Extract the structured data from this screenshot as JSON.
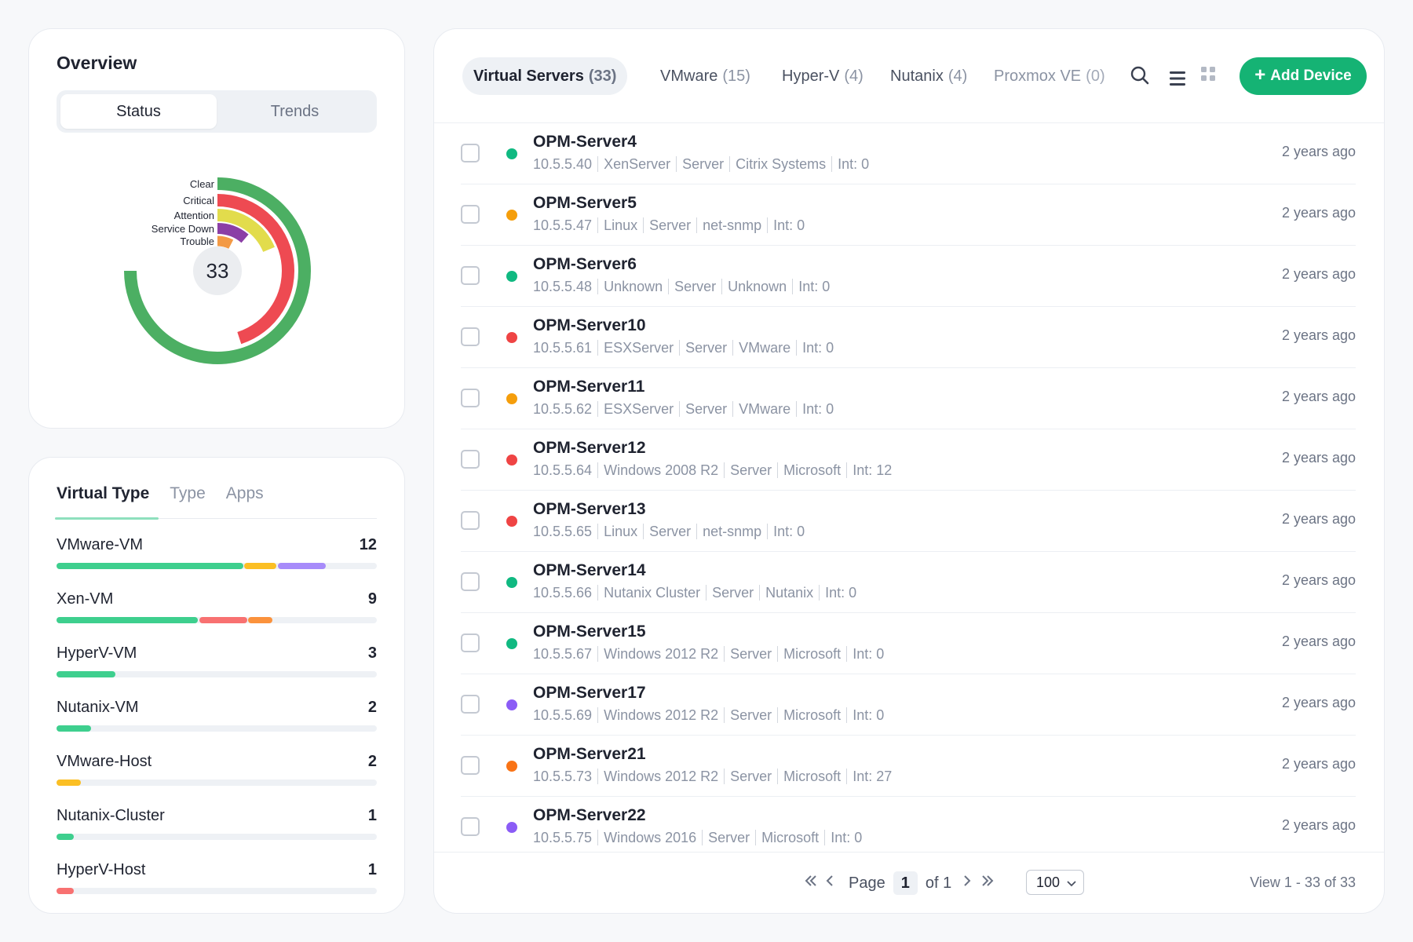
{
  "overview": {
    "title": "Overview",
    "tabs": [
      "Status",
      "Trends"
    ],
    "active_tab": "Status",
    "donut": {
      "total": "33",
      "series": [
        {
          "label": "Clear",
          "value": 20,
          "color": "#4caf63"
        },
        {
          "label": "Critical",
          "value": 12,
          "color": "#ee4a52"
        },
        {
          "label": "Attention",
          "value": 5,
          "color": "#e2dc4c"
        },
        {
          "label": "Service Down",
          "value": 3,
          "color": "#8b3fa6"
        },
        {
          "label": "Trouble",
          "value": 2,
          "color": "#f39a45"
        }
      ]
    }
  },
  "virtual_type": {
    "tabs": [
      "Virtual Type",
      "Type",
      "Apps"
    ],
    "active_tab": "Virtual Type",
    "items": [
      {
        "name": "VMware-VM",
        "count": "12",
        "segments": [
          {
            "value": 7,
            "color": "#3ecf8e"
          },
          {
            "value": 1.2,
            "color": "#fbbf24"
          },
          {
            "value": 1.8,
            "color": "#a78bfa"
          }
        ],
        "total": 12
      },
      {
        "name": "Xen-VM",
        "count": "9",
        "segments": [
          {
            "value": 5.3,
            "color": "#3ecf8e"
          },
          {
            "value": 1.8,
            "color": "#f87171"
          },
          {
            "value": 0.9,
            "color": "#fb923c"
          }
        ],
        "total": 12
      },
      {
        "name": "HyperV-VM",
        "count": "3",
        "segments": [
          {
            "value": 2.2,
            "color": "#3ecf8e"
          }
        ],
        "total": 12
      },
      {
        "name": "Nutanix-VM",
        "count": "2",
        "segments": [
          {
            "value": 1.3,
            "color": "#3ecf8e"
          }
        ],
        "total": 12
      },
      {
        "name": "VMware-Host",
        "count": "2",
        "segments": [
          {
            "value": 0.9,
            "color": "#fbbf24"
          }
        ],
        "total": 12
      },
      {
        "name": "Nutanix-Cluster",
        "count": "1",
        "segments": [
          {
            "value": 0.65,
            "color": "#3ecf8e"
          }
        ],
        "total": 12
      },
      {
        "name": "HyperV-Host",
        "count": "1",
        "segments": [
          {
            "value": 0.65,
            "color": "#f87171"
          }
        ],
        "total": 12
      }
    ]
  },
  "main": {
    "tabs": [
      {
        "label": "Virtual Servers",
        "count": "(33)"
      },
      {
        "label": "VMware",
        "count": "(15)"
      },
      {
        "label": "Hyper-V",
        "count": "(4)"
      },
      {
        "label": "Nutanix",
        "count": "(4)"
      },
      {
        "label": "Proxmox VE",
        "count": "(0)"
      }
    ],
    "active_tab": "Virtual Servers",
    "icons": {
      "search": "search-icon",
      "list": "list-view-icon",
      "grid": "grid-view-icon"
    },
    "add_label": "Add Device",
    "status_colors": {
      "clear": "#10b981",
      "attention": "#f59e0b",
      "critical": "#ef4444",
      "service_down": "#8b5cf6",
      "trouble": "#f97316"
    },
    "devices": [
      {
        "name": "OPM-Server4",
        "ip": "10.5.5.40",
        "os": "XenServer",
        "type": "Server",
        "vendor": "Citrix Systems",
        "int": "Int: 0",
        "time": "2 years ago",
        "status": "clear"
      },
      {
        "name": "OPM-Server5",
        "ip": "10.5.5.47",
        "os": "Linux",
        "type": "Server",
        "vendor": "net-snmp",
        "int": "Int: 0",
        "time": "2 years ago",
        "status": "attention"
      },
      {
        "name": "OPM-Server6",
        "ip": "10.5.5.48",
        "os": "Unknown",
        "type": "Server",
        "vendor": "Unknown",
        "int": "Int: 0",
        "time": "2 years ago",
        "status": "clear"
      },
      {
        "name": "OPM-Server10",
        "ip": "10.5.5.61",
        "os": "ESXServer",
        "type": "Server",
        "vendor": "VMware",
        "int": "Int: 0",
        "time": "2 years ago",
        "status": "critical"
      },
      {
        "name": "OPM-Server11",
        "ip": "10.5.5.62",
        "os": "ESXServer",
        "type": "Server",
        "vendor": "VMware",
        "int": "Int: 0",
        "time": "2 years ago",
        "status": "attention"
      },
      {
        "name": "OPM-Server12",
        "ip": "10.5.5.64",
        "os": "Windows 2008 R2",
        "type": "Server",
        "vendor": "Microsoft",
        "int": "Int: 12",
        "time": "2 years ago",
        "status": "critical"
      },
      {
        "name": "OPM-Server13",
        "ip": "10.5.5.65",
        "os": "Linux",
        "type": "Server",
        "vendor": "net-snmp",
        "int": "Int: 0",
        "time": "2 years ago",
        "status": "critical"
      },
      {
        "name": "OPM-Server14",
        "ip": "10.5.5.66",
        "os": "Nutanix Cluster",
        "type": "Server",
        "vendor": "Nutanix",
        "int": "Int: 0",
        "time": "2 years ago",
        "status": "clear"
      },
      {
        "name": "OPM-Server15",
        "ip": "10.5.5.67",
        "os": "Windows 2012 R2",
        "type": "Server",
        "vendor": "Microsoft",
        "int": "Int: 0",
        "time": "2 years ago",
        "status": "clear"
      },
      {
        "name": "OPM-Server17",
        "ip": "10.5.5.69",
        "os": "Windows 2012 R2",
        "type": "Server",
        "vendor": "Microsoft",
        "int": "Int: 0",
        "time": "2 years ago",
        "status": "service_down"
      },
      {
        "name": "OPM-Server21",
        "ip": "10.5.5.73",
        "os": "Windows 2012 R2",
        "type": "Server",
        "vendor": "Microsoft",
        "int": "Int: 27",
        "time": "2 years ago",
        "status": "trouble"
      },
      {
        "name": "OPM-Server22",
        "ip": "10.5.5.75",
        "os": "Windows 2016",
        "type": "Server",
        "vendor": "Microsoft",
        "int": "Int: 0",
        "time": "2 years ago",
        "status": "service_down"
      }
    ],
    "pagination": {
      "page_label": "Page",
      "page": "1",
      "of_label": "of 1",
      "per_page": "100",
      "view_text": "View 1 - 33 of 33"
    }
  }
}
